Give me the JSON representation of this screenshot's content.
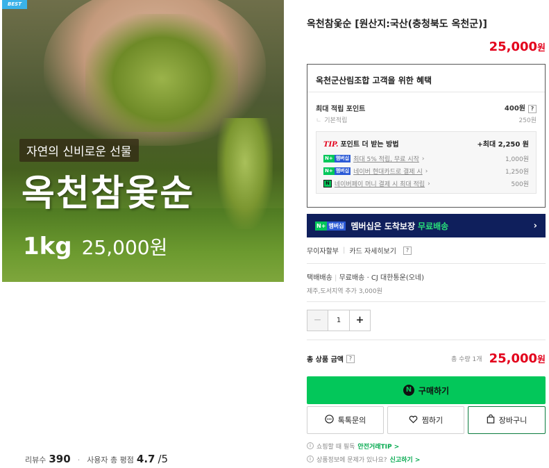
{
  "image": {
    "badge": "BEST",
    "tagline": "자연의 신비로운 선물",
    "headline": "옥천참옻순",
    "weight": "1kg",
    "price": "25,000원"
  },
  "left_footer": {
    "review_label": "리뷰수",
    "review_count": "390",
    "rating_label": "사용자 총 평점",
    "rating": "4.7",
    "rating_max": "/5"
  },
  "product": {
    "title": "옥천참옻순 [원산지:국산(충청북도 옥천군)]",
    "price": "25,000",
    "price_unit": "원"
  },
  "benefit": {
    "heading": "옥천군산림조합 고객을 위한 혜택",
    "max_points_label": "최대 적립 포인트",
    "max_points_value": "400원",
    "base_label": "기본적립",
    "base_value": "250원",
    "tip_label": "TIP.",
    "tip_text": "포인트 더 받는 방법",
    "tip_max": "+최대 2,250 원",
    "tips": [
      {
        "badge": "멤버십",
        "text": "최대 5% 적립, 무료 시작",
        "value": "1,000원"
      },
      {
        "badge": "멤버십",
        "text": "네이버 현대카드로 결제 시",
        "value": "1,250원"
      },
      {
        "badge": "N",
        "text": "네이버페이 머니 결제 시 최대 적립",
        "value": "500원"
      }
    ]
  },
  "membership": {
    "text": "멤버십은 도착보장",
    "highlight": "무료배송"
  },
  "installment": {
    "label": "무이자할부",
    "link": "카드 자세히보기"
  },
  "shipping": {
    "label": "택배배송",
    "fee": "무료배송",
    "carrier": "· CJ 대한통운(오네)",
    "extra": "제주,도서지역 추가 3,000원"
  },
  "quantity": {
    "minus": "−",
    "value": "1",
    "plus": "+"
  },
  "total": {
    "label": "총 상품 금액",
    "count": "총 수량 1개",
    "amount": "25,000",
    "unit": "원"
  },
  "buttons": {
    "buy": "구매하기",
    "talk": "톡톡문의",
    "wish": "찜하기",
    "cart": "장바구니"
  },
  "notes": {
    "n1": "쇼핑할 때 필독",
    "n1_link": "안전거래TIP >",
    "n2": "상품정보에 문제가 있나요?",
    "n2_link": "신고하기 >"
  },
  "colors": {
    "accent_red": "#e3001b",
    "naver_green": "#03c75a",
    "membership_navy": "#0f1f5c"
  }
}
